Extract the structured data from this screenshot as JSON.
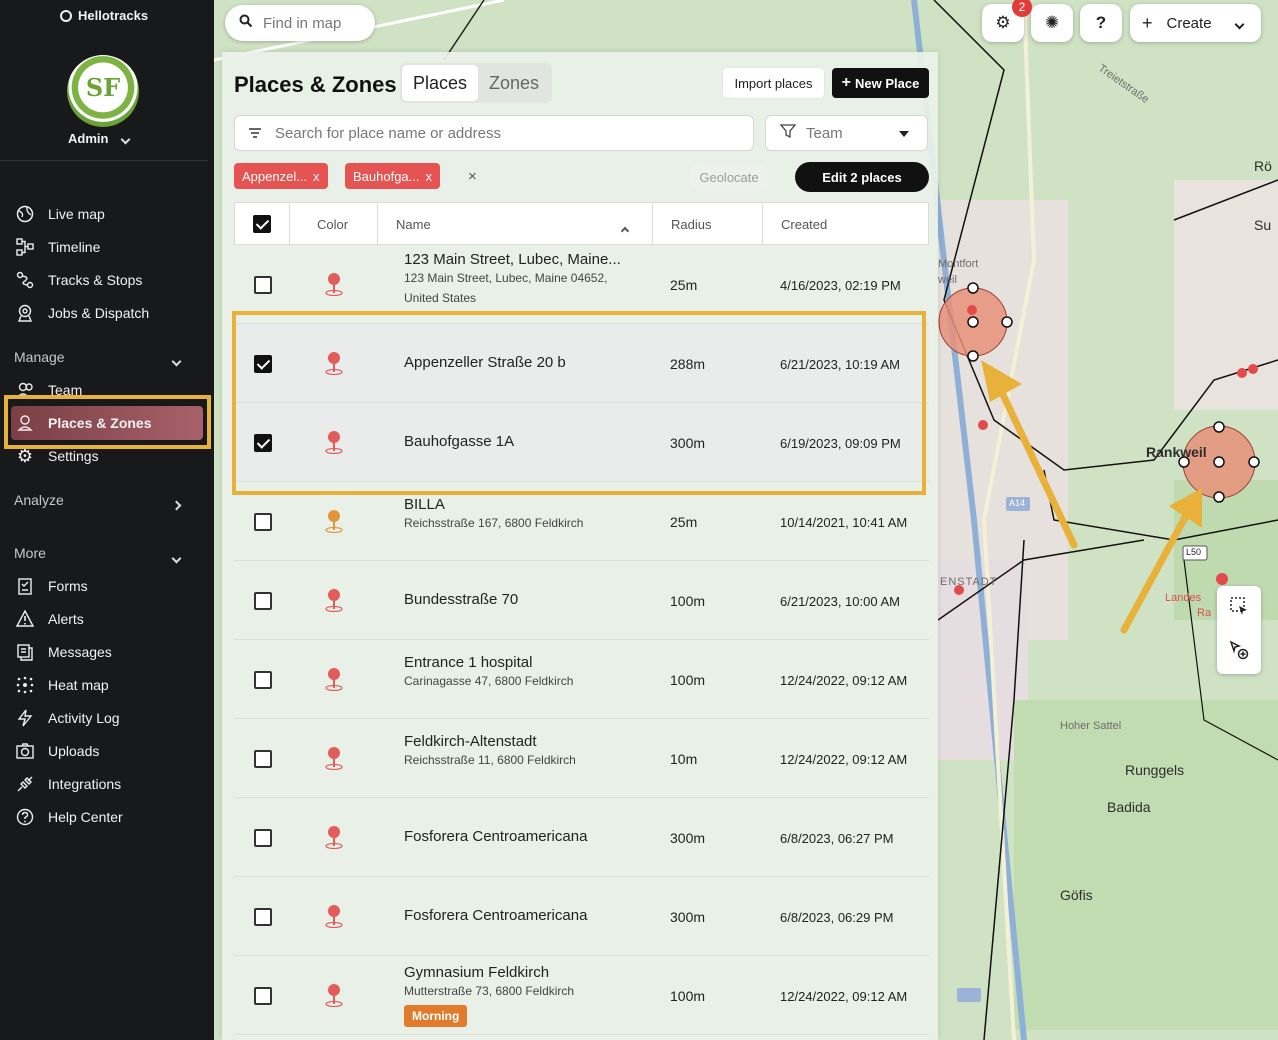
{
  "app": {
    "brand": "Hellotracks",
    "user": "Admin",
    "avatar_initials": "SF"
  },
  "sidebar": {
    "primary": [
      {
        "label": "Live map",
        "icon": "globe-icon"
      },
      {
        "label": "Timeline",
        "icon": "timeline-icon"
      },
      {
        "label": "Tracks & Stops",
        "icon": "route-icon"
      },
      {
        "label": "Jobs & Dispatch",
        "icon": "dispatch-icon"
      }
    ],
    "manage_label": "Manage",
    "manage": [
      {
        "label": "Team",
        "icon": "team-icon"
      },
      {
        "label": "Places & Zones",
        "icon": "place-icon"
      },
      {
        "label": "Settings",
        "icon": "gear-icon"
      }
    ],
    "analyze_label": "Analyze",
    "more_label": "More",
    "more": [
      {
        "label": "Forms",
        "icon": "forms-icon"
      },
      {
        "label": "Alerts",
        "icon": "alert-icon"
      },
      {
        "label": "Messages",
        "icon": "messages-icon"
      },
      {
        "label": "Heat map",
        "icon": "heatmap-icon"
      },
      {
        "label": "Activity Log",
        "icon": "activity-icon"
      },
      {
        "label": "Uploads",
        "icon": "upload-icon"
      },
      {
        "label": "Integrations",
        "icon": "integrations-icon"
      },
      {
        "label": "Help Center",
        "icon": "help-icon"
      }
    ]
  },
  "topbar": {
    "find_placeholder": "Find in map",
    "notifications_count": "2",
    "help_label": "?",
    "create_label": "Create"
  },
  "panel": {
    "title": "Places & Zones",
    "tabs": [
      {
        "label": "Places",
        "active": true
      },
      {
        "label": "Zones",
        "active": false
      }
    ],
    "import_label": "Import places",
    "new_label": "New Place",
    "search_placeholder": "Search for place name or address",
    "team_placeholder": "Team",
    "chips": [
      {
        "label": "Appenzel..."
      },
      {
        "label": "Bauhofga..."
      }
    ],
    "chip_close": "x",
    "clear_all": "×",
    "geolocate_label": "Geolocate",
    "edit_label": "Edit 2 places"
  },
  "table": {
    "headers": {
      "color": "Color",
      "name": "Name",
      "radius": "Radius",
      "created": "Created"
    },
    "rows": [
      {
        "name": "123 Main Street, Lubec, Maine...",
        "address": "123 Main Street, Lubec, Maine 04652, United States",
        "radius": "25m",
        "created": "4/16/2023, 02:19 PM",
        "checked": false,
        "pin_color": "#e25c5c"
      },
      {
        "name": "Appenzeller Straße 20 b",
        "address": "",
        "radius": "288m",
        "created": "6/21/2023, 10:19 AM",
        "checked": true,
        "pin_color": "#e25c5c"
      },
      {
        "name": "Bauhofgasse 1A",
        "address": "",
        "radius": "300m",
        "created": "6/19/2023, 09:09 PM",
        "checked": true,
        "pin_color": "#e25c5c"
      },
      {
        "name": "BILLA",
        "address": "Reichsstraße 167, 6800 Feldkirch",
        "radius": "25m",
        "created": "10/14/2021, 10:41 AM",
        "checked": false,
        "pin_color": "#e0973a"
      },
      {
        "name": "Bundesstraße 70",
        "address": "",
        "radius": "100m",
        "created": "6/21/2023, 10:00 AM",
        "checked": false,
        "pin_color": "#e25c5c"
      },
      {
        "name": "Entrance 1 hospital",
        "address": "Carinagasse 47, 6800 Feldkirch",
        "radius": "100m",
        "created": "12/24/2022, 09:12 AM",
        "checked": false,
        "pin_color": "#e25c5c"
      },
      {
        "name": "Feldkirch-Altenstadt",
        "address": "Reichsstraße 11, 6800 Feldkirch",
        "radius": "10m",
        "created": "12/24/2022, 09:12 AM",
        "checked": false,
        "pin_color": "#e25c5c"
      },
      {
        "name": "Fosforera Centroamericana",
        "address": "",
        "radius": "300m",
        "created": "6/8/2023, 06:27 PM",
        "checked": false,
        "pin_color": "#e25c5c"
      },
      {
        "name": "Fosforera Centroamericana",
        "address": "",
        "radius": "300m",
        "created": "6/8/2023, 06:29 PM",
        "checked": false,
        "pin_color": "#e25c5c"
      },
      {
        "name": "Gymnasium Feldkirch",
        "address": "Mutterstraße 73, 6800 Feldkirch",
        "radius": "100m",
        "created": "12/24/2022, 09:12 AM",
        "checked": false,
        "pin_color": "#e25c5c",
        "tag": "Morning"
      }
    ]
  },
  "map": {
    "labels": [
      "Treietstraße",
      "Montfort",
      "weil",
      "Rankweil",
      "ENSTADT",
      "Hoher Sattel",
      "Runggels",
      "Badida",
      "Göfis",
      "Landes",
      "Ra",
      "Rö",
      "Su",
      "A14",
      "L50"
    ]
  }
}
